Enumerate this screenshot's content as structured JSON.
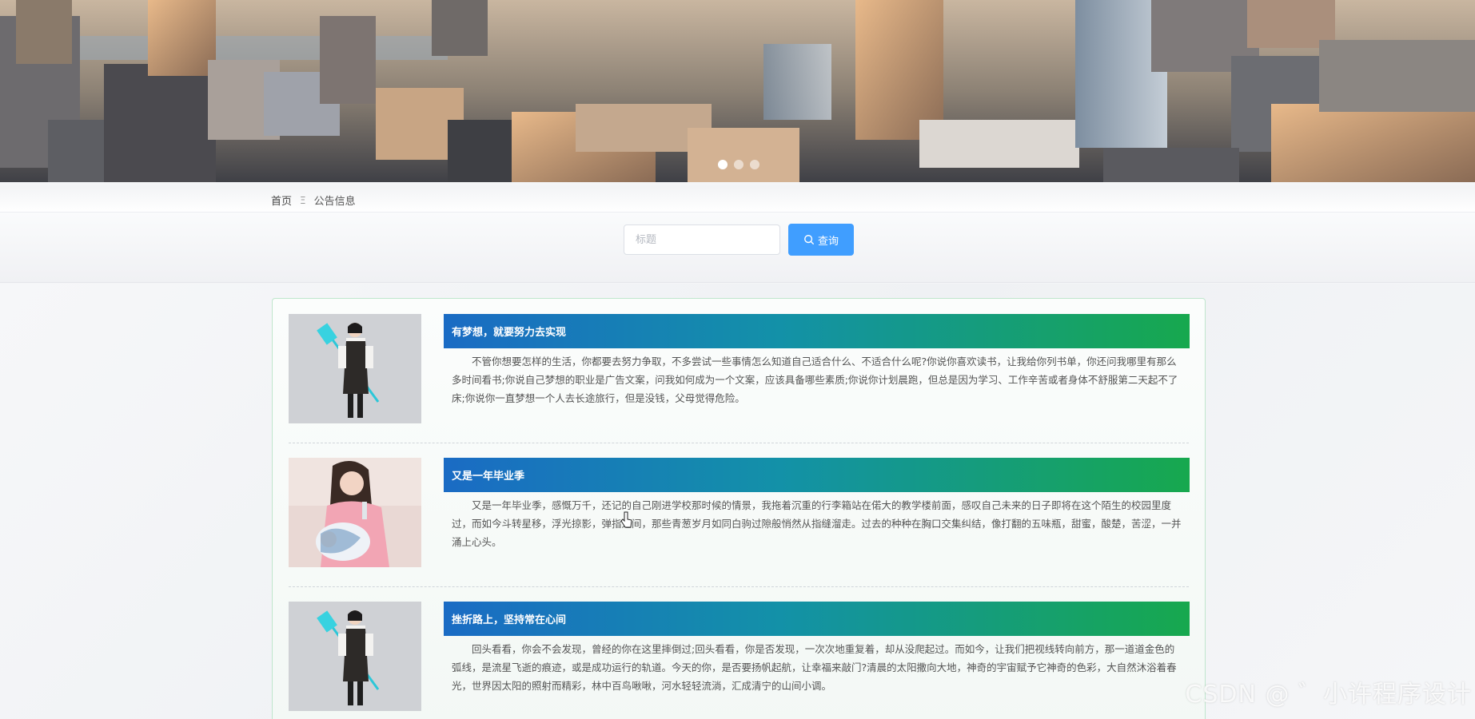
{
  "banner": {
    "carousel_dots": 3,
    "active_dot": 0
  },
  "breadcrumb": {
    "home": "首页",
    "separator": "Ξ",
    "current": "公告信息"
  },
  "search": {
    "placeholder": "标题",
    "button_label": "查询"
  },
  "notices": [
    {
      "title": "有梦想，就要努力去实现",
      "body": "不管你想要怎样的生活，你都要去努力争取，不多尝试一些事情怎么知道自己适合什么、不适合什么呢?你说你喜欢读书，让我给你列书单，你还问我哪里有那么多时间看书;你说自己梦想的职业是广告文案，问我如何成为一个文案，应该具备哪些素质;你说你计划晨跑，但总是因为学习、工作辛苦或者身体不舒服第二天起不了床;你说你一直梦想一个人去长途旅行，但是没钱，父母觉得危险。"
    },
    {
      "title": "又是一年毕业季",
      "body": "又是一年毕业季，感慨万千，还记的自己刚进学校那时候的情景，我拖着沉重的行李箱站在偌大的教学楼前面，感叹自己未来的日子即将在这个陌生的校园里度过，而如今斗转星移，浮光掠影，弹指之间，那些青葱岁月如同白驹过隙般悄然从指缝溜走。过去的种种在胸口交集纠结，像打翻的五味瓶，甜蜜，酸楚，苦涩，一并涌上心头。"
    },
    {
      "title": "挫折路上，坚持常在心间",
      "body": "回头看看，你会不会发现，曾经的你在这里摔倒过;回头看看，你是否发现，一次次地重复着，却从没爬起过。而如今，让我们把视线转向前方，那一道道金色的弧线，是流星飞逝的痕迹，或是成功运行的轨道。今天的你，是否要扬帆起航，让幸福来敲门?清晨的太阳撒向大地，神奇的宇宙赋予它神奇的色彩，大自然沐浴着春光，世界因太阳的照射而精彩，林中百鸟啾啾，河水轻轻流淌，汇成清宁的山间小调。"
    }
  ],
  "watermark": "CSDN @ ゛小许程序设计",
  "colors": {
    "accent": "#409eff",
    "title_gradient_start": "#1a6bc4",
    "title_gradient_end": "#17a84e",
    "panel_border": "#bfe6cc"
  }
}
